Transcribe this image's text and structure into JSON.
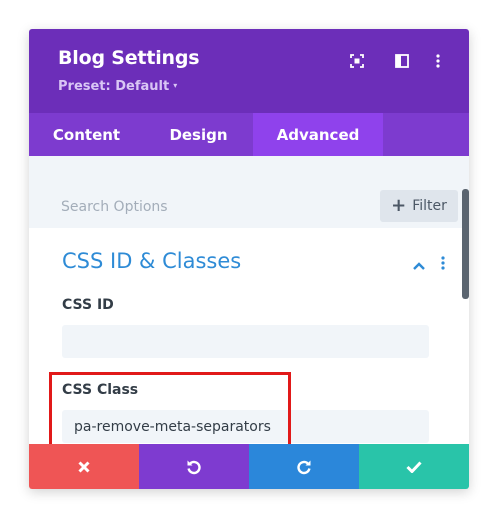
{
  "header": {
    "title": "Blog Settings",
    "preset": "Preset: Default",
    "preset_caret": "▾"
  },
  "tabs": [
    {
      "label": "Content"
    },
    {
      "label": "Design"
    },
    {
      "label": "Advanced"
    }
  ],
  "search": {
    "placeholder": "Search Options",
    "filter_label": "Filter",
    "filter_plus": "+"
  },
  "section": {
    "title": "CSS ID & Classes"
  },
  "fields": {
    "css_id": {
      "label": "CSS ID",
      "value": ""
    },
    "css_class": {
      "label": "CSS Class",
      "value": "pa-remove-meta-separators"
    }
  },
  "colors": {
    "header": "#6c2eb9",
    "tabs": "#7d3bcf",
    "active_tab": "#8f42ec",
    "section_title": "#2e8bd6",
    "highlight_border": "#e11919",
    "cancel": "#ef5555",
    "undo": "#7e3bd0",
    "redo": "#2b87da",
    "save": "#29c4a9"
  },
  "icons": {
    "focus": "focus-icon",
    "split": "split-view-icon",
    "more": "more-icon",
    "collapse": "chevron-up-icon",
    "section_more": "more-icon",
    "cancel": "close-icon",
    "undo": "undo-icon",
    "redo": "redo-icon",
    "save": "check-icon"
  }
}
